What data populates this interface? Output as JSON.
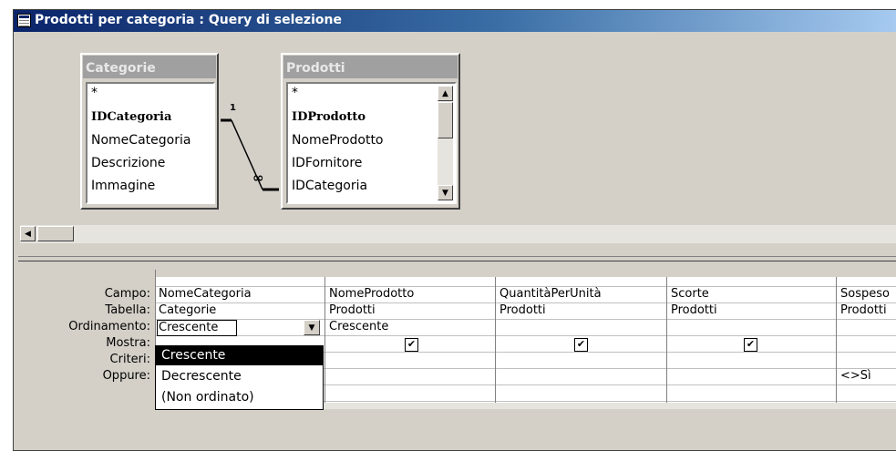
{
  "window": {
    "title": "Prodotti per categoria : Query di selezione",
    "icon": "query-icon"
  },
  "tables": [
    {
      "name": "Categorie",
      "fields": [
        "*",
        "IDCategoria",
        "NomeCategoria",
        "Descrizione",
        "Immagine"
      ],
      "key_field": "IDCategoria"
    },
    {
      "name": "Prodotti",
      "fields": [
        "*",
        "IDProdotto",
        "NomeProdotto",
        "IDFornitore",
        "IDCategoria"
      ],
      "key_field": "IDProdotto"
    }
  ],
  "relationship": {
    "one_label": "1",
    "many_label": "∞"
  },
  "grid": {
    "row_labels": [
      "Campo:",
      "Tabella:",
      "Ordinamento:",
      "Mostra:",
      "Criteri:",
      "Oppure:"
    ],
    "columns": [
      {
        "campo": "NomeCategoria",
        "tabella": "Categorie",
        "ordinamento": "Crescente",
        "mostra": true,
        "criteri": ""
      },
      {
        "campo": "NomeProdotto",
        "tabella": "Prodotti",
        "ordinamento": "Crescente",
        "mostra": true,
        "criteri": ""
      },
      {
        "campo": "QuantitàPerUnità",
        "tabella": "Prodotti",
        "ordinamento": "",
        "mostra": true,
        "criteri": ""
      },
      {
        "campo": "Scorte",
        "tabella": "Prodotti",
        "ordinamento": "",
        "mostra": true,
        "criteri": ""
      },
      {
        "campo": "Sospeso",
        "tabella": "Prodotti",
        "ordinamento": "",
        "mostra": false,
        "criteri": "<>Sì"
      }
    ]
  },
  "sort_dropdown": {
    "selected": "Crescente",
    "options": [
      "Crescente",
      "Decrescente",
      "(Non ordinato)"
    ]
  },
  "icons": {
    "scroll_up": "▲",
    "scroll_down": "▼",
    "scroll_left": "◀",
    "dropdown_arrow": "▼",
    "check": "✔"
  }
}
